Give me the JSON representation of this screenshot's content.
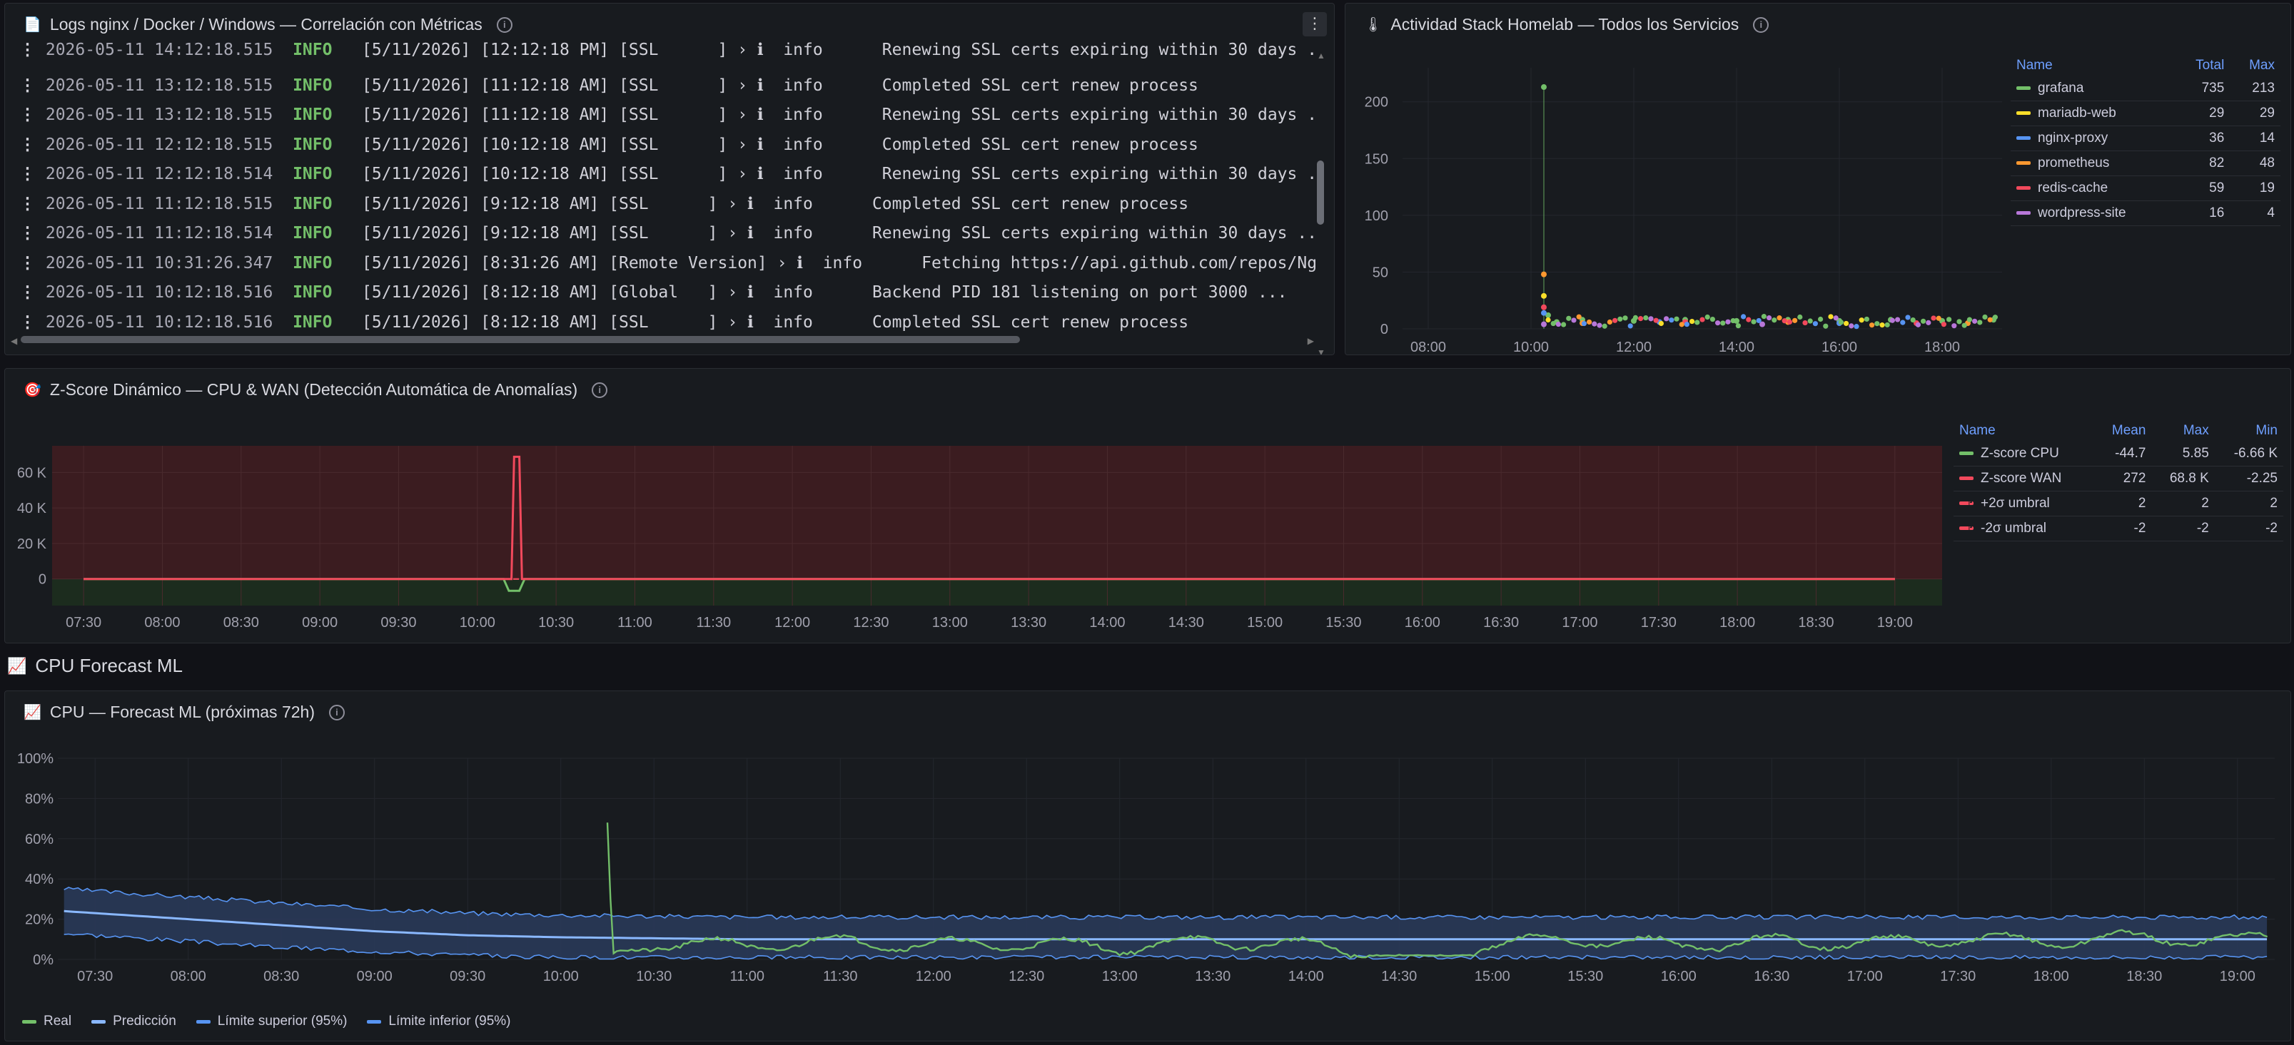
{
  "logs_panel": {
    "title": "Logs nginx / Docker / Windows — Correlación con Métricas",
    "icon": "document-icon",
    "rows": [
      {
        "ts": "2026-05-11 14:12:18.515",
        "lvl": "INFO",
        "msg": "[5/11/2026] [12:12:18 PM] [SSL      ] › ℹ  info      Renewing SSL certs expiring within 30 days ..."
      },
      {
        "ts": "2026-05-11 13:12:18.515",
        "lvl": "INFO",
        "msg": "[5/11/2026] [11:12:18 AM] [SSL      ] › ℹ  info      Completed SSL cert renew process"
      },
      {
        "ts": "2026-05-11 13:12:18.515",
        "lvl": "INFO",
        "msg": "[5/11/2026] [11:12:18 AM] [SSL      ] › ℹ  info      Renewing SSL certs expiring within 30 days ..."
      },
      {
        "ts": "2026-05-11 12:12:18.515",
        "lvl": "INFO",
        "msg": "[5/11/2026] [10:12:18 AM] [SSL      ] › ℹ  info      Completed SSL cert renew process"
      },
      {
        "ts": "2026-05-11 12:12:18.514",
        "lvl": "INFO",
        "msg": "[5/11/2026] [10:12:18 AM] [SSL      ] › ℹ  info      Renewing SSL certs expiring within 30 days ..."
      },
      {
        "ts": "2026-05-11 11:12:18.515",
        "lvl": "INFO",
        "msg": "[5/11/2026] [9:12:18 AM] [SSL      ] › ℹ  info      Completed SSL cert renew process"
      },
      {
        "ts": "2026-05-11 11:12:18.514",
        "lvl": "INFO",
        "msg": "[5/11/2026] [9:12:18 AM] [SSL      ] › ℹ  info      Renewing SSL certs expiring within 30 days ..."
      },
      {
        "ts": "2026-05-11 10:31:26.347",
        "lvl": "INFO",
        "msg": "[5/11/2026] [8:31:26 AM] [Remote Version] › ℹ  info      Fetching https://api.github.com/repos/NginxProxyMana"
      },
      {
        "ts": "2026-05-11 10:12:18.516",
        "lvl": "INFO",
        "msg": "[5/11/2026] [8:12:18 AM] [Global   ] › ℹ  info      Backend PID 181 listening on port 3000 ..."
      },
      {
        "ts": "2026-05-11 10:12:18.516",
        "lvl": "INFO",
        "msg": "[5/11/2026] [8:12:18 AM] [SSL      ] › ℹ  info      Completed SSL cert renew process"
      }
    ]
  },
  "activity_panel": {
    "title": "Actividad Stack Homelab — Todos los Servicios",
    "icon": "thermometer-icon",
    "legend_headers": {
      "name": "Name",
      "total": "Total",
      "max": "Max"
    },
    "legend": [
      {
        "name": "grafana",
        "total": "735",
        "max": "213",
        "color": "#73bf69"
      },
      {
        "name": "mariadb-web",
        "total": "29",
        "max": "29",
        "color": "#fade2a"
      },
      {
        "name": "nginx-proxy",
        "total": "36",
        "max": "14",
        "color": "#5794f2"
      },
      {
        "name": "prometheus",
        "total": "82",
        "max": "48",
        "color": "#ff9830"
      },
      {
        "name": "redis-cache",
        "total": "59",
        "max": "19",
        "color": "#f2495c"
      },
      {
        "name": "wordpress-site",
        "total": "16",
        "max": "4",
        "color": "#b877d9"
      }
    ],
    "yticks": [
      "200",
      "150",
      "100",
      "50",
      "0"
    ],
    "xticks": [
      "08:00",
      "10:00",
      "12:00",
      "14:00",
      "16:00",
      "18:00"
    ]
  },
  "zscore_panel": {
    "title": "Z-Score Dinámico — CPU & WAN (Detección Automática de Anomalías)",
    "icon": "target-icon",
    "legend_headers": {
      "name": "Name",
      "mean": "Mean",
      "max": "Max",
      "min": "Min"
    },
    "legend": [
      {
        "name": "Z-score CPU",
        "mean": "-44.7",
        "max": "5.85",
        "min": "-6.66 K",
        "color": "#73bf69",
        "dash": false
      },
      {
        "name": "Z-score WAN",
        "mean": "272",
        "max": "68.8 K",
        "min": "-2.25",
        "color": "#f2495c",
        "dash": false
      },
      {
        "name": "+2σ umbral",
        "mean": "2",
        "max": "2",
        "min": "2",
        "color": "#f2495c",
        "dash": true
      },
      {
        "name": "-2σ umbral",
        "mean": "-2",
        "max": "-2",
        "min": "-2",
        "color": "#f2495c",
        "dash": true
      }
    ],
    "yticks": [
      "60 K",
      "40 K",
      "20 K",
      "0"
    ],
    "xticks": [
      "07:30",
      "08:00",
      "08:30",
      "09:00",
      "09:30",
      "10:00",
      "10:30",
      "11:00",
      "11:30",
      "12:00",
      "12:30",
      "13:00",
      "13:30",
      "14:00",
      "14:30",
      "15:00",
      "15:30",
      "16:00",
      "16:30",
      "17:00",
      "17:30",
      "18:00",
      "18:30",
      "19:00"
    ]
  },
  "section": {
    "title": "CPU Forecast ML",
    "icon": "chart-icon"
  },
  "forecast_panel": {
    "title": "CPU — Forecast ML (próximas 72h)",
    "icon": "chart-icon",
    "yticks": [
      "100%",
      "80%",
      "60%",
      "40%",
      "20%",
      "0%"
    ],
    "xticks": [
      "07:30",
      "08:00",
      "08:30",
      "09:00",
      "09:30",
      "10:00",
      "10:30",
      "11:00",
      "11:30",
      "12:00",
      "12:30",
      "13:00",
      "13:30",
      "14:00",
      "14:30",
      "15:00",
      "15:30",
      "16:00",
      "16:30",
      "17:00",
      "17:30",
      "18:00",
      "18:30",
      "19:00"
    ],
    "legend": [
      {
        "name": "Real",
        "color": "#73bf69"
      },
      {
        "name": "Predicción",
        "color": "#8ab8ff"
      },
      {
        "name": "Límite superior (95%)",
        "color": "#5794f2"
      },
      {
        "name": "Límite inferior (95%)",
        "color": "#5794f2"
      }
    ]
  },
  "chart_data": [
    {
      "type": "scatter",
      "title": "Actividad Stack Homelab — Todos los Servicios",
      "ylim": [
        0,
        230
      ],
      "x_range": [
        "07:30",
        "19:00"
      ],
      "series": [
        {
          "name": "grafana",
          "points": [
            [
              "10:15",
              213
            ],
            [
              "10:20",
              12
            ],
            [
              "10:30",
              6
            ],
            [
              "11:00",
              8
            ],
            [
              "12:00",
              7
            ],
            [
              "13:00",
              8
            ],
            [
              "14:00",
              7
            ],
            [
              "15:00",
              8
            ],
            [
              "16:00",
              7
            ],
            [
              "17:00",
              8
            ],
            [
              "18:00",
              7
            ],
            [
              "19:00",
              8
            ]
          ]
        },
        {
          "name": "mariadb-web",
          "points": [
            [
              "10:15",
              29
            ]
          ]
        },
        {
          "name": "nginx-proxy",
          "points": [
            [
              "10:15",
              14
            ],
            [
              "12:30",
              6
            ],
            [
              "16:00",
              5
            ]
          ]
        },
        {
          "name": "prometheus",
          "points": [
            [
              "10:15",
              48
            ],
            [
              "11:00",
              5
            ],
            [
              "15:00",
              6
            ],
            [
              "18:30",
              5
            ]
          ]
        },
        {
          "name": "redis-cache",
          "points": [
            [
              "10:15",
              19
            ],
            [
              "13:00",
              6
            ],
            [
              "17:30",
              5
            ]
          ]
        },
        {
          "name": "wordpress-site",
          "points": [
            [
              "10:15",
              4
            ],
            [
              "14:30",
              4
            ]
          ]
        }
      ]
    },
    {
      "type": "line",
      "title": "Z-Score Dinámico — CPU & WAN (Detección Automática de Anomalías)",
      "ylim": [
        -15000,
        75000
      ],
      "x_range": [
        "07:30",
        "19:00"
      ],
      "series": [
        {
          "name": "Z-score CPU",
          "points": [
            [
              "07:30",
              0
            ],
            [
              "10:10",
              0
            ],
            [
              "10:12",
              -6660
            ],
            [
              "10:16",
              -6660
            ],
            [
              "10:18",
              0
            ],
            [
              "19:00",
              0
            ]
          ]
        },
        {
          "name": "Z-score WAN",
          "points": [
            [
              "07:30",
              0
            ],
            [
              "10:13",
              0
            ],
            [
              "10:14",
              68800
            ],
            [
              "10:16",
              68800
            ],
            [
              "10:17",
              0
            ],
            [
              "19:00",
              0
            ]
          ]
        },
        {
          "name": "+2σ umbral",
          "points": [
            [
              "07:30",
              2
            ],
            [
              "19:00",
              2
            ]
          ]
        },
        {
          "name": "-2σ umbral",
          "points": [
            [
              "07:30",
              -2
            ],
            [
              "19:00",
              -2
            ]
          ]
        }
      ]
    },
    {
      "type": "area",
      "title": "CPU — Forecast ML (próximas 72h)",
      "ylim": [
        0,
        100
      ],
      "x_range": [
        "07:20",
        "19:10"
      ],
      "series": [
        {
          "name": "Real",
          "points": [
            [
              "10:15",
              68
            ],
            [
              "10:17",
              30
            ],
            [
              "10:18",
              3
            ],
            [
              "10:30",
              8
            ],
            [
              "11:00",
              7
            ],
            [
              "11:30",
              9
            ],
            [
              "12:00",
              7
            ],
            [
              "12:30",
              8
            ],
            [
              "13:00",
              6
            ],
            [
              "13:30",
              9
            ],
            [
              "14:00",
              7
            ],
            [
              "14:30",
              2
            ],
            [
              "15:00",
              8
            ],
            [
              "15:30",
              10
            ],
            [
              "16:00",
              7
            ],
            [
              "16:30",
              9
            ],
            [
              "17:00",
              8
            ],
            [
              "17:30",
              10
            ],
            [
              "18:00",
              9
            ],
            [
              "18:30",
              11
            ],
            [
              "19:00",
              9
            ],
            [
              "19:10",
              12
            ]
          ]
        },
        {
          "name": "Predicción",
          "points": [
            [
              "07:20",
              24
            ],
            [
              "08:00",
              20
            ],
            [
              "08:30",
              17
            ],
            [
              "09:00",
              14
            ],
            [
              "09:30",
              12
            ],
            [
              "10:00",
              11
            ],
            [
              "11:00",
              10
            ],
            [
              "19:10",
              10
            ]
          ]
        },
        {
          "name": "Límite superior (95%)",
          "points": [
            [
              "07:20",
              35
            ],
            [
              "08:00",
              31
            ],
            [
              "08:30",
              28
            ],
            [
              "09:00",
              25
            ],
            [
              "09:30",
              23
            ],
            [
              "10:00",
              22
            ],
            [
              "11:00",
              21
            ],
            [
              "19:10",
              21
            ]
          ]
        },
        {
          "name": "Límite inferior (95%)",
          "points": [
            [
              "07:20",
              13
            ],
            [
              "08:00",
              9
            ],
            [
              "08:30",
              6
            ],
            [
              "09:00",
              4
            ],
            [
              "09:30",
              2
            ],
            [
              "10:00",
              1
            ],
            [
              "11:00",
              1
            ],
            [
              "19:10",
              1
            ]
          ]
        }
      ]
    }
  ]
}
